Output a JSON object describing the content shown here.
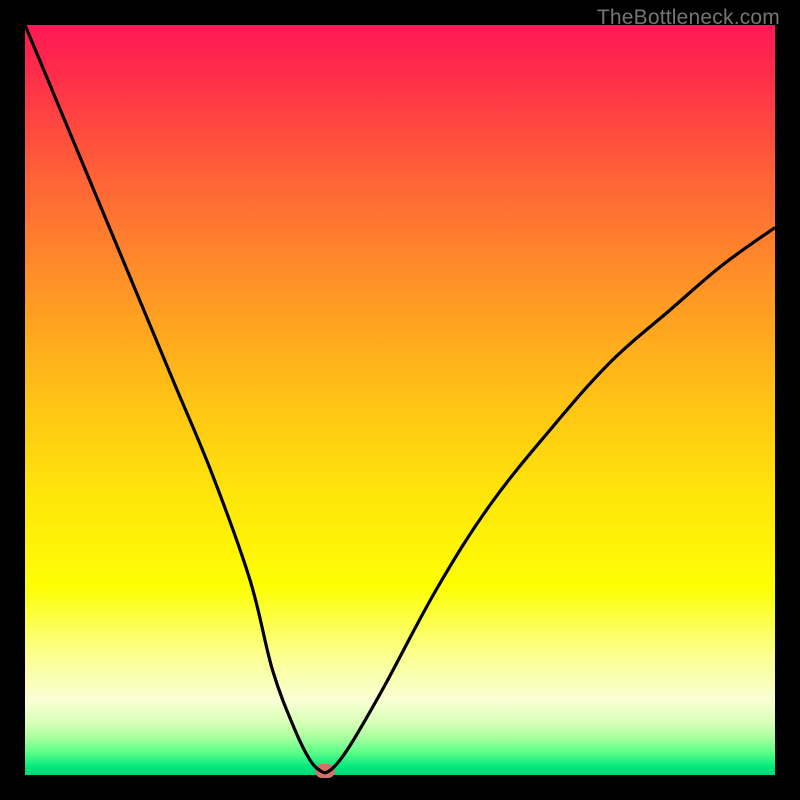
{
  "watermark": "TheBottleneck.com",
  "chart_data": {
    "type": "line",
    "title": "",
    "xlabel": "",
    "ylabel": "",
    "xlim": [
      0,
      100
    ],
    "ylim": [
      0,
      100
    ],
    "series": [
      {
        "name": "bottleneck-curve",
        "x": [
          0,
          5,
          10,
          15,
          20,
          25,
          30,
          33,
          36,
          38,
          39.5,
          40.5,
          42,
          44,
          48,
          55,
          62,
          70,
          78,
          86,
          93,
          100
        ],
        "y": [
          100,
          88,
          76,
          64,
          52,
          40,
          26,
          14,
          6,
          2,
          0.5,
          0.5,
          2,
          5,
          12,
          25,
          36,
          46,
          55,
          62,
          68,
          73
        ]
      }
    ],
    "marker": {
      "x": 40,
      "y": 0.5,
      "color": "#d1716c"
    },
    "gradient_stops": [
      {
        "pos": 0,
        "color": "#ff1956"
      },
      {
        "pos": 50,
        "color": "#ffc800"
      },
      {
        "pos": 80,
        "color": "#fdff04"
      },
      {
        "pos": 100,
        "color": "#00d878"
      }
    ]
  }
}
